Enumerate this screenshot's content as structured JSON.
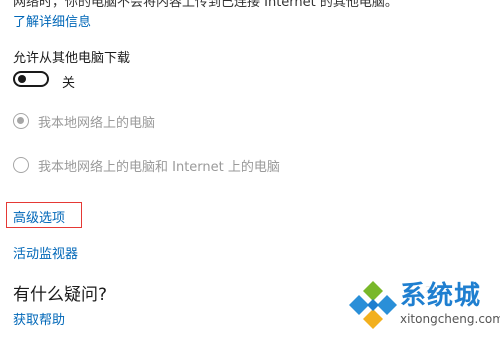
{
  "intro": {
    "text": "网络时，你的电脑不会将内容上传到已连接 Internet 的其他电脑。",
    "learn_more": "了解详细信息"
  },
  "download_section": {
    "label": "允许从其他电脑下载",
    "toggle_state": "关",
    "toggle_on": false
  },
  "options": [
    {
      "label": "我本地网络上的电脑",
      "selected": true,
      "disabled": true
    },
    {
      "label": "我本地网络上的电脑和 Internet 上的电脑",
      "selected": false,
      "disabled": true
    }
  ],
  "links": {
    "advanced": "高级选项",
    "activity_monitor": "活动监视器",
    "get_help": "获取帮助"
  },
  "help": {
    "question": "有什么疑问?"
  },
  "watermark": {
    "title": "系统城",
    "url": "xitongcheng.com",
    "faint": "20"
  },
  "colors": {
    "link": "#0067b8",
    "highlight_border": "#e53935",
    "disabled_text": "#9a9a9a",
    "watermark_blue": "#1f7fd0"
  }
}
